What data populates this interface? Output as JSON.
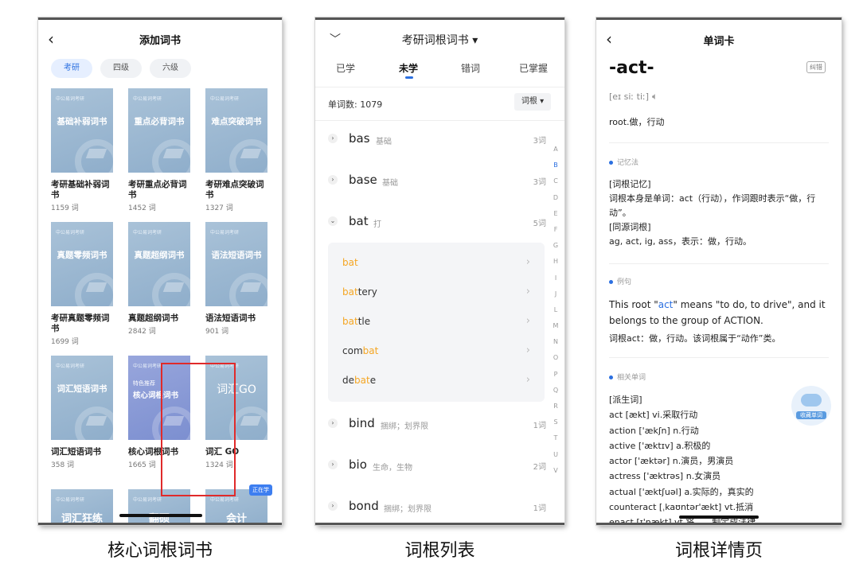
{
  "phone1": {
    "title": "添加词书",
    "back_icon": "‹",
    "chips": [
      "考研",
      "四级",
      "六级"
    ],
    "brand": "中公易词考研",
    "books": [
      {
        "cover": "基础补弱词书",
        "name": "考研基础补弱词书",
        "count": "1159 词"
      },
      {
        "cover": "重点必背词书",
        "name": "考研重点必背词书",
        "count": "1452 词"
      },
      {
        "cover": "难点突破词书",
        "name": "考研难点突破词书",
        "count": "1327 词"
      },
      {
        "cover": "真题零频词书",
        "name": "考研真题零频词书",
        "count": "1699 词"
      },
      {
        "cover": "真题超纲词书",
        "name": "真题超纲词书",
        "count": "2842 词"
      },
      {
        "cover": "语法短语词书",
        "name": "语法短语词书",
        "count": "901 词"
      },
      {
        "cover": "词汇短语词书",
        "name": "词汇短语词书",
        "count": "358 词"
      },
      {
        "cover": "核心词根词书",
        "tag": "特色推荐",
        "name": "核心词根词书",
        "count": "1665 词"
      },
      {
        "cover": "词汇GO",
        "name": "词汇 GO",
        "count": "1324 词"
      }
    ],
    "peek": [
      "词汇狂练",
      "翻硕",
      "会计"
    ],
    "learning_badge": "正在学"
  },
  "phone2": {
    "title": "考研词根词书 ▾",
    "chevron": "﹀",
    "tabs": [
      "已学",
      "未学",
      "错词",
      "已掌握"
    ],
    "count": "单词数: 1079",
    "sort": "词根 ▾",
    "roots": [
      {
        "word": "bas",
        "meaning": "基础",
        "count": "3词",
        "icon": "›"
      },
      {
        "word": "base",
        "meaning": "基础",
        "count": "3词",
        "icon": "›"
      },
      {
        "word": "bat",
        "meaning": "打",
        "count": "5词",
        "icon": "⌄"
      },
      {
        "word": "bind",
        "meaning": "捆绑；划界限",
        "count": "1词",
        "icon": "›"
      },
      {
        "word": "bio",
        "meaning": "生命，生物",
        "count": "2词",
        "icon": "›"
      },
      {
        "word": "bond",
        "meaning": "捆绑；划界限",
        "count": "1词",
        "icon": "›"
      }
    ],
    "sub_items": [
      {
        "pre": "",
        "hl": "bat",
        "post": ""
      },
      {
        "pre": "",
        "hl": "bat",
        "post": "tery"
      },
      {
        "pre": "",
        "hl": "bat",
        "post": "tle"
      },
      {
        "pre": "com",
        "hl": "bat",
        "post": ""
      },
      {
        "pre": "de",
        "hl": "bat",
        "post": "e"
      }
    ],
    "alphabet": [
      "A",
      "B",
      "C",
      "D",
      "E",
      "F",
      "G",
      "H",
      "I",
      "J",
      "L",
      "M",
      "N",
      "O",
      "P",
      "Q",
      "R",
      "S",
      "T",
      "U",
      "V"
    ]
  },
  "phone3": {
    "title": "单词卡",
    "word": "-act-",
    "correct": "纠错",
    "phonetic": "[eɪ siː tiː]",
    "meaning": "root.做，行动",
    "mnemonic_label": "记忆法",
    "mnemonic": [
      "[词根记忆]",
      "词根本身是单词：act（行动），作词跟时表示“做，行动”。",
      "[同源词根]",
      "ag, act, ig, ass，表示：做，行动。"
    ],
    "example_label": "例句",
    "example_pre": "This root \"",
    "example_hl": "act",
    "example_post": "\" means \"to do, to drive\", and it belongs to the group of ACTION.",
    "example_cn": "词根act：做，行动。该词根属于“动作”类。",
    "related_label": "相关单词",
    "related": [
      "[派生词]",
      "act [ækt] vi.采取行动",
      "action ['ækʃn] n.行动",
      "active ['æktɪv] a.积极的",
      "actor ['æktər] n.演员，男演员",
      "actress ['æktrəs] n.女演员",
      "actual ['æktʃuəl] a.实际的，真实的",
      "counteract [ˌkaʊntər'ækt] vt.抵消",
      "enact [ɪ'nækt] vt.将……制定成法律"
    ],
    "collect": "收藏单词"
  },
  "captions": [
    "核心词根词书",
    "词根列表",
    "词根详情页"
  ],
  "colors": {
    "accent": "#2b6fe0",
    "highlight": "#f5a623",
    "frame": "#e02a2a"
  }
}
